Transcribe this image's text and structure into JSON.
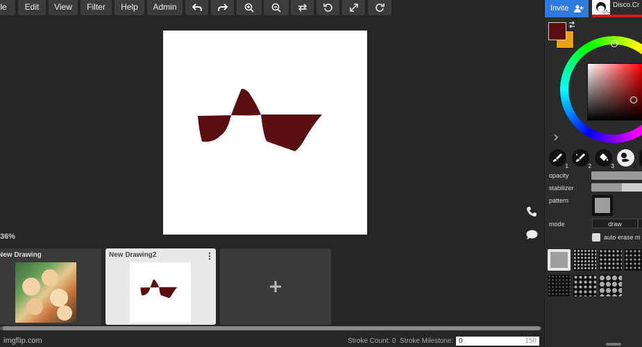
{
  "menu": {
    "items": [
      "File",
      "Edit",
      "View",
      "Filter",
      "Help",
      "Admin"
    ],
    "icons": [
      "undo-icon",
      "redo-icon",
      "zoom-in-icon",
      "zoom-out-icon",
      "swap-icon",
      "rotate-left-icon",
      "fullscreen-icon",
      "refresh-icon"
    ]
  },
  "canvas": {
    "zoom_label": "36%",
    "stroke_color": "#5a0e10"
  },
  "drawings": [
    {
      "title": "New Drawing"
    },
    {
      "title": "New Drawing2"
    }
  ],
  "status": {
    "site": "imgflip.com",
    "stroke_count_label": "Stroke Count: 0",
    "stroke_milestone_label": "Stroke Milestone:",
    "milestone_value": "0",
    "milestone_max": "150"
  },
  "right_panel": {
    "invite_label": "Invite",
    "username": "Disco.Cr",
    "primary_color": "#5a0e10",
    "secondary_color": "#e8a317",
    "tool_numbers": [
      "1",
      "2",
      "3",
      "4"
    ],
    "opacity_label": "opacity",
    "opacity_value": 1.0,
    "stabilizer_label": "stabilizer",
    "stabilizer_value": 0.55,
    "pattern_label": "pattern",
    "mode_label": "mode",
    "mode_value": "draw",
    "auto_erase_label": "auto erase m"
  }
}
